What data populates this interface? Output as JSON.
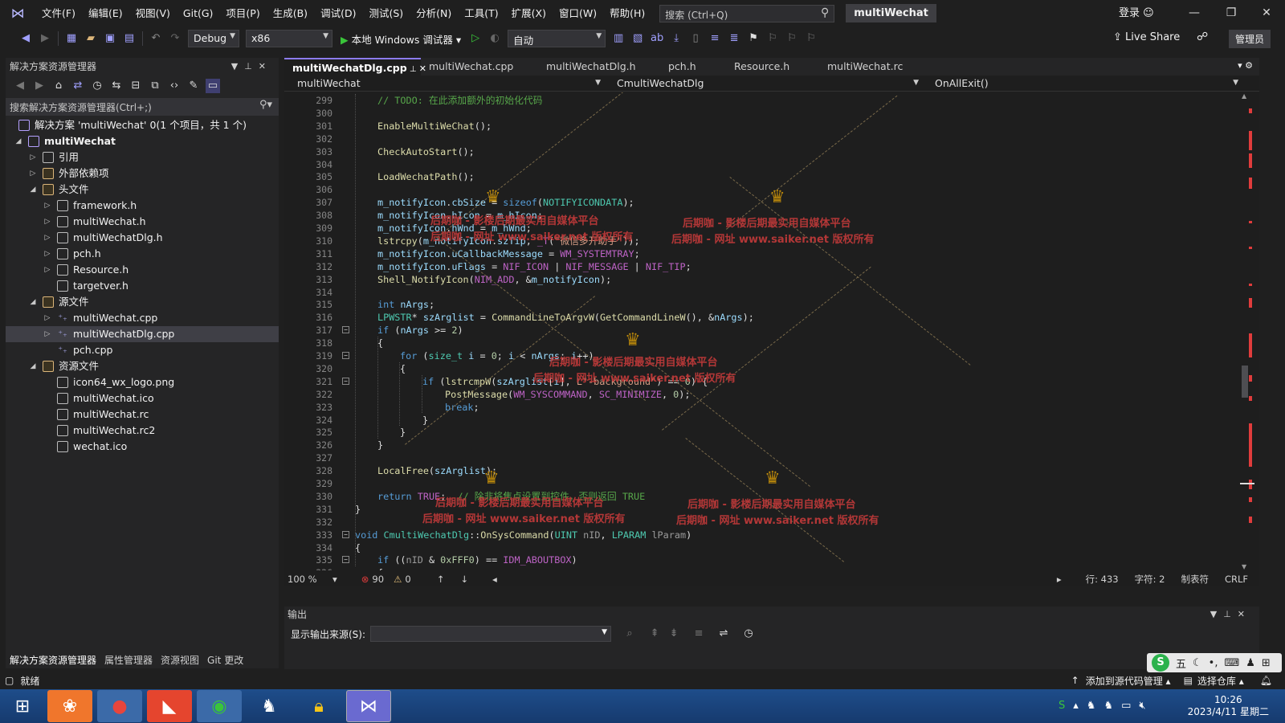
{
  "titlebar": {
    "menus": [
      "文件(F)",
      "编辑(E)",
      "视图(V)",
      "Git(G)",
      "项目(P)",
      "生成(B)",
      "调试(D)",
      "测试(S)",
      "分析(N)",
      "工具(T)",
      "扩展(X)",
      "窗口(W)",
      "帮助(H)"
    ],
    "search_placeholder": "搜索 (Ctrl+Q)",
    "solution_name": "multiWechat",
    "login": "登录"
  },
  "toolbar": {
    "config": "Debug",
    "platform": "x86",
    "run_label": "本地 Windows 调试器",
    "auto": "自动",
    "live_share": "Live Share",
    "admin": "管理员"
  },
  "solution_explorer": {
    "title": "解决方案资源管理器",
    "search_placeholder": "搜索解决方案资源管理器(Ctrl+;)",
    "tree": [
      {
        "label": "解决方案 'multiWechat' 0(1 个项目，共 1 个)",
        "depth": 0,
        "exp": "",
        "icon": "sol"
      },
      {
        "label": "multiWechat",
        "depth": 0,
        "exp": "open",
        "icon": "proj",
        "bold": true
      },
      {
        "label": "引用",
        "depth": 1,
        "exp": "closed",
        "icon": "ref"
      },
      {
        "label": "外部依赖项",
        "depth": 1,
        "exp": "closed",
        "icon": "folder"
      },
      {
        "label": "头文件",
        "depth": 1,
        "exp": "open",
        "icon": "folder"
      },
      {
        "label": "framework.h",
        "depth": 2,
        "exp": "closed",
        "icon": "file"
      },
      {
        "label": "multiWechat.h",
        "depth": 2,
        "exp": "closed",
        "icon": "file"
      },
      {
        "label": "multiWechatDlg.h",
        "depth": 2,
        "exp": "closed",
        "icon": "file"
      },
      {
        "label": "pch.h",
        "depth": 2,
        "exp": "closed",
        "icon": "file"
      },
      {
        "label": "Resource.h",
        "depth": 2,
        "exp": "closed",
        "icon": "file"
      },
      {
        "label": "targetver.h",
        "depth": 2,
        "exp": "",
        "icon": "file"
      },
      {
        "label": "源文件",
        "depth": 1,
        "exp": "open",
        "icon": "folder"
      },
      {
        "label": "multiWechat.cpp",
        "depth": 2,
        "exp": "closed",
        "icon": "cpp"
      },
      {
        "label": "multiWechatDlg.cpp",
        "depth": 2,
        "exp": "closed",
        "icon": "cpp",
        "selected": true
      },
      {
        "label": "pch.cpp",
        "depth": 2,
        "exp": "",
        "icon": "cpp"
      },
      {
        "label": "资源文件",
        "depth": 1,
        "exp": "open",
        "icon": "folder"
      },
      {
        "label": "icon64_wx_logo.png",
        "depth": 2,
        "exp": "",
        "icon": "img"
      },
      {
        "label": "multiWechat.ico",
        "depth": 2,
        "exp": "",
        "icon": "img"
      },
      {
        "label": "multiWechat.rc",
        "depth": 2,
        "exp": "",
        "icon": "file"
      },
      {
        "label": "multiWechat.rc2",
        "depth": 2,
        "exp": "",
        "icon": "file"
      },
      {
        "label": "wechat.ico",
        "depth": 2,
        "exp": "",
        "icon": "img"
      }
    ],
    "bottom_tabs": [
      "解决方案资源管理器",
      "属性管理器",
      "资源视图",
      "Git 更改"
    ]
  },
  "editor": {
    "tabs": [
      "multiWechatDlg.cpp",
      "multiWechat.cpp",
      "multiWechatDlg.h",
      "pch.h",
      "Resource.h",
      "multiWechat.rc"
    ],
    "nav_project": "multiWechat",
    "nav_class": "CmultiWechatDlg",
    "nav_member": "OnAllExit()",
    "lines": [
      {
        "n": "299",
        "html": "<span class=\"cm\">// TODO: 在此添加额外的初始化代码</span>",
        "i": 1
      },
      {
        "n": "300",
        "html": "",
        "i": 1
      },
      {
        "n": "301",
        "html": "<span class=\"fn\">EnableMultiWeChat</span>();",
        "i": 1
      },
      {
        "n": "302",
        "html": "",
        "i": 1
      },
      {
        "n": "303",
        "html": "<span class=\"fn\">CheckAutoStart</span>();",
        "i": 1
      },
      {
        "n": "304",
        "html": "",
        "i": 1
      },
      {
        "n": "305",
        "html": "<span class=\"fn\">LoadWechatPath</span>();",
        "i": 1
      },
      {
        "n": "306",
        "html": "",
        "i": 1
      },
      {
        "n": "307",
        "html": "<span class=\"vr\">m_notifyIcon</span>.<span class=\"vr\">cbSize</span> = <span class=\"kw\">sizeof</span>(<span class=\"ty\">NOTIFYICONDATA</span>);",
        "i": 1
      },
      {
        "n": "308",
        "html": "<span class=\"vr\">m_notifyIcon</span>.<span class=\"vr\">hIcon</span> = <span class=\"vr\">m_hIcon</span>;",
        "i": 1
      },
      {
        "n": "309",
        "html": "<span class=\"vr\">m_notifyIcon</span>.<span class=\"vr\">hWnd</span> = <span class=\"vr\">m_hWnd</span>;",
        "i": 1
      },
      {
        "n": "310",
        "html": "<span class=\"fn\">lstrcpy</span>(<span class=\"vr\">m_notifyIcon</span>.<span class=\"vr\">szTip</span>, <span class=\"mc\">_T</span>(<span class=\"st\">\"微信多开助手\"</span>));",
        "i": 1
      },
      {
        "n": "311",
        "html": "<span class=\"vr\">m_notifyIcon</span>.<span class=\"vr\">uCallbackMessage</span> = <span class=\"mc\">WM_SYSTEMTRAY</span>;",
        "i": 1
      },
      {
        "n": "312",
        "html": "<span class=\"vr\">m_notifyIcon</span>.<span class=\"vr\">uFlags</span> = <span class=\"mc\">NIF_ICON</span> | <span class=\"mc\">NIF_MESSAGE</span> | <span class=\"mc\">NIF_TIP</span>;",
        "i": 1
      },
      {
        "n": "313",
        "html": "<span class=\"fn\">Shell_NotifyIcon</span>(<span class=\"mc\">NIM_ADD</span>, &amp;<span class=\"vr\">m_notifyIcon</span>);",
        "i": 1
      },
      {
        "n": "314",
        "html": "",
        "i": 1
      },
      {
        "n": "315",
        "html": "<span class=\"kw\">int</span> <span class=\"vr\">nArgs</span>;",
        "i": 1
      },
      {
        "n": "316",
        "html": "<span class=\"ty\">LPWSTR</span>* <span class=\"vr\">szArglist</span> = <span class=\"fn\">CommandLineToArgvW</span>(<span class=\"fn\">GetCommandLineW</span>(), &amp;<span class=\"vr\">nArgs</span>);",
        "i": 1
      },
      {
        "n": "317",
        "html": "<span class=\"kw\">if</span> (<span class=\"vr\">nArgs</span> &gt;= <span class=\"nm\">2</span>)",
        "i": 1,
        "fold": true
      },
      {
        "n": "318",
        "html": "{",
        "i": 1
      },
      {
        "n": "319",
        "html": "<span class=\"kw\">for</span> (<span class=\"ty\">size_t</span> <span class=\"vr\">i</span> = <span class=\"nm\">0</span>; <span class=\"vr\">i</span> &lt; <span class=\"vr\">nArgs</span>; <span class=\"vr\">i</span>++)",
        "i": 2,
        "fold": true
      },
      {
        "n": "320",
        "html": "{",
        "i": 2
      },
      {
        "n": "321",
        "html": "<span class=\"kw\">if</span> (<span class=\"fn\">lstrcmpW</span>(<span class=\"vr\">szArglist</span>[<span class=\"vr\">i</span>], <span class=\"st\">L\"-background\"</span>) == <span class=\"nm\">0</span>) {",
        "i": 3,
        "fold": true
      },
      {
        "n": "322",
        "html": "<span class=\"fn\">PostMessage</span>(<span class=\"mc\">WM_SYSCOMMAND</span>, <span class=\"mc\">SC_MINIMIZE</span>, <span class=\"nm\">0</span>);",
        "i": 4
      },
      {
        "n": "323",
        "html": "<span class=\"kw\">break</span>;",
        "i": 4
      },
      {
        "n": "324",
        "html": "}",
        "i": 3
      },
      {
        "n": "325",
        "html": "}",
        "i": 2
      },
      {
        "n": "326",
        "html": "}",
        "i": 1
      },
      {
        "n": "327",
        "html": "",
        "i": 1
      },
      {
        "n": "328",
        "html": "<span class=\"fn\">LocalFree</span>(<span class=\"vr\">szArglist</span>);",
        "i": 1
      },
      {
        "n": "329",
        "html": "",
        "i": 1
      },
      {
        "n": "330",
        "html": "<span class=\"kw\">return</span> <span class=\"mc\">TRUE</span>;  <span class=\"cm\">// 除非将焦点设置到控件，否则返回 TRUE</span>",
        "i": 1
      },
      {
        "n": "331",
        "html": "}",
        "i": 0
      },
      {
        "n": "332",
        "html": "",
        "i": 0
      },
      {
        "n": "333",
        "html": "<span class=\"kw\">void</span> <span class=\"ty\">CmultiWechatDlg</span>::<span class=\"fn\">OnSysCommand</span>(<span class=\"ty\">UINT</span> <span class=\"pm\">nID</span>, <span class=\"ty\">LPARAM</span> <span class=\"pm\">lParam</span>)",
        "i": 0,
        "fold": true
      },
      {
        "n": "334",
        "html": "{",
        "i": 0
      },
      {
        "n": "335",
        "html": "<span class=\"kw\">if</span> ((<span class=\"pm\">nID</span> &amp; <span class=\"nm\">0xFFF0</span>) == <span class=\"mc\">IDM_ABOUTBOX</span>)",
        "i": 1,
        "fold": true
      },
      {
        "n": "336",
        "html": "{",
        "i": 1
      }
    ],
    "watermark_line1": "后期咖 - 影楼后期最实用自媒体平台",
    "watermark_line2": "后期咖 - 网址 www.saiker.net 版权所有",
    "status": {
      "zoom": "100 %",
      "errors": "90",
      "warnings": "0",
      "line": "行: 433",
      "col": "字符: 2",
      "tabs": "制表符",
      "eol": "CRLF"
    }
  },
  "output": {
    "title": "输出",
    "source_label": "显示输出来源(S):"
  },
  "statusbar": {
    "ready": "就绪",
    "add_source": "添加到源代码管理",
    "select_repo": "选择仓库"
  },
  "ime": {
    "mode": "五"
  },
  "taskbar": {
    "time": "10:26",
    "date": "2023/4/11 星期二"
  }
}
